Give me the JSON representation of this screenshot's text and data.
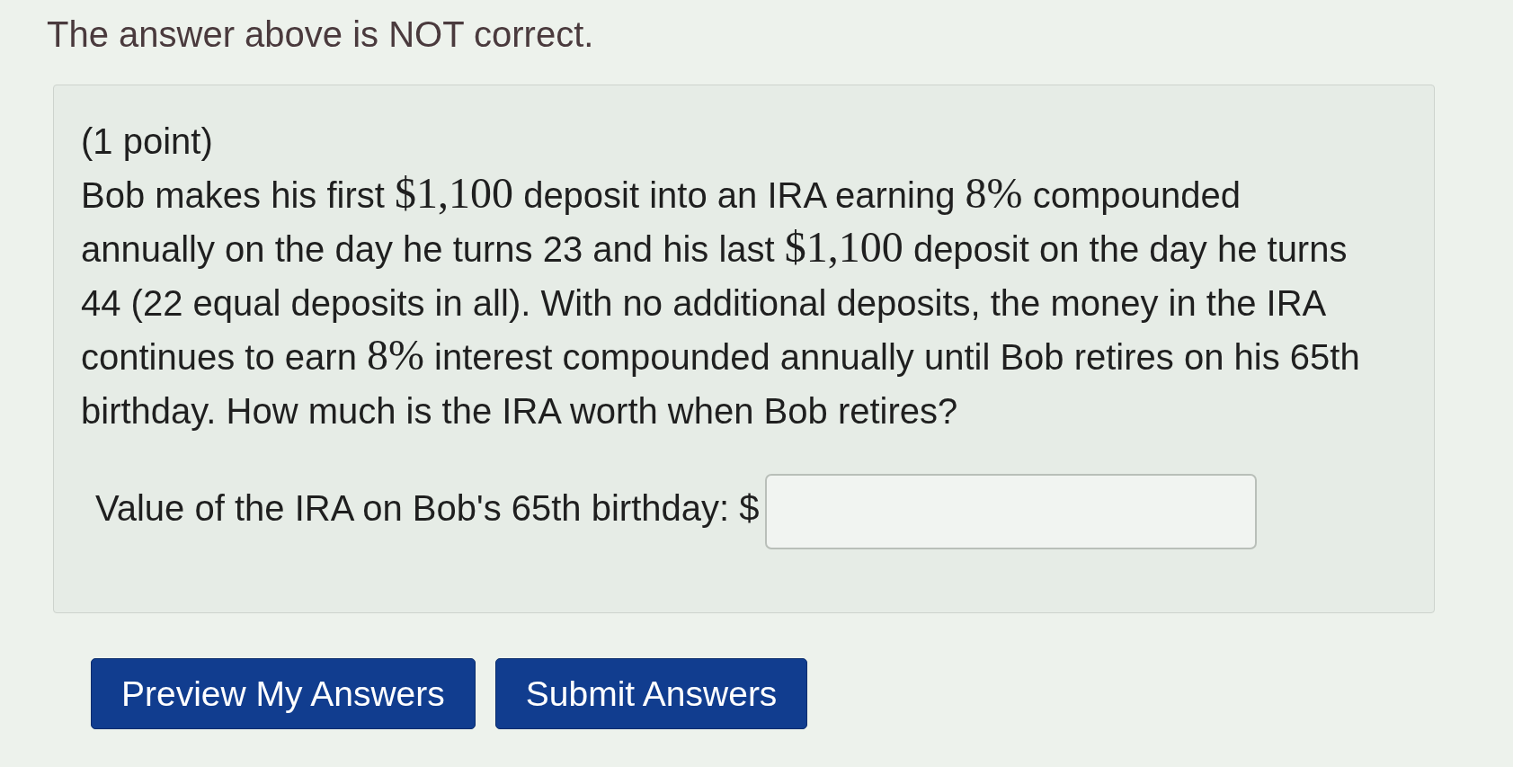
{
  "heading": "The answer above is NOT correct.",
  "problem": {
    "points": "(1 point)",
    "statement": [
      {
        "kind": "text",
        "text": "Bob makes his first "
      },
      {
        "kind": "math",
        "text": "$1,100"
      },
      {
        "kind": "text",
        "text": " deposit into an IRA earning "
      },
      {
        "kind": "math",
        "text": "8%"
      },
      {
        "kind": "text",
        "text": " compounded annually on the day he turns 23 and his last "
      },
      {
        "kind": "math",
        "text": "$1,100"
      },
      {
        "kind": "text",
        "text": " deposit on the day he turns 44 (22 equal deposits in all). With no additional deposits, the money in the IRA continues to earn "
      },
      {
        "kind": "math",
        "text": "8%"
      },
      {
        "kind": "text",
        "text": " interest compounded annually until Bob retires on his 65th birthday. How much is the IRA worth when Bob retires?"
      }
    ],
    "answer_label": "Value of the IRA on Bob's 65th birthday: $"
  },
  "buttons": [
    {
      "label": "Preview My Answers"
    },
    {
      "label": "Submit Answers"
    }
  ]
}
